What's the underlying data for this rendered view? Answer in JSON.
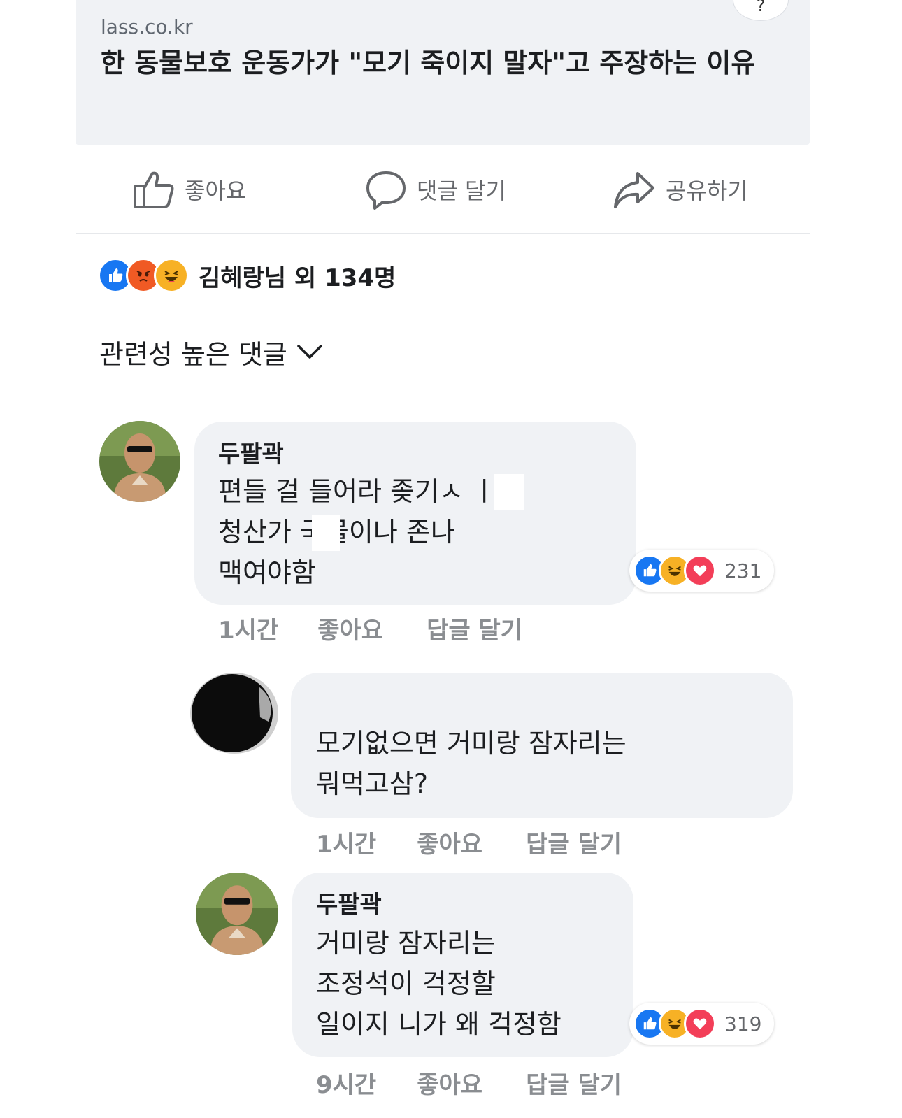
{
  "link_preview": {
    "domain": "lass.co.kr",
    "title": "한 동물보호 운동가가 \"모기 죽이지 말자\"고 주장하는 이유"
  },
  "actions": {
    "like": "좋아요",
    "comment": "댓글 달기",
    "share": "공유하기"
  },
  "reactions_summary": {
    "text": "김혜랑님 외 134명",
    "icons": [
      "like-icon",
      "angry-icon",
      "haha-icon"
    ]
  },
  "sort": {
    "label": "관련성 높은 댓글"
  },
  "comments": [
    {
      "author": "두팔곽",
      "lines": [
        "편들 걸 들어라 좆기ㅅ      ㅣ들",
        "청산가     국물이나 존나",
        "맥여야함"
      ],
      "reaction_count": "231",
      "time": "1시간",
      "like": "좋아요",
      "reply": "답글 달기"
    },
    {
      "author": "",
      "lines": [
        "모기없으면 거미랑 잠자리는",
        "뭐먹고삼?"
      ],
      "time": "1시간",
      "like": "좋아요",
      "reply": "답글 달기"
    },
    {
      "author": "두팔곽",
      "lines": [
        "거미랑 잠자리는",
        "조정석이 걱정할",
        "일이지 니가 왜 걱정함"
      ],
      "reaction_count": "319",
      "time": "9시간",
      "like": "좋아요",
      "reply": "답글 달기"
    }
  ],
  "colors": {
    "like_blue": "#1877f2",
    "angry_orange": "#f05a24",
    "haha_yellow": "#f7b125",
    "love_red": "#f33e58",
    "bubble_gray": "#f0f2f5"
  }
}
